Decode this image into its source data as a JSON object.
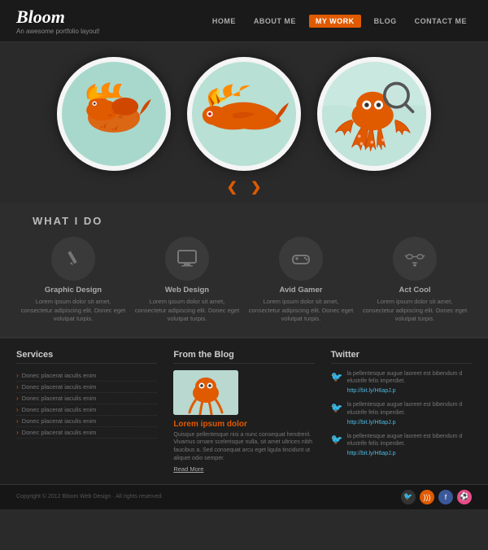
{
  "header": {
    "logo": "Bloom",
    "tagline": "An awesome portfolio layout!",
    "nav": [
      {
        "label": "HOME",
        "active": false
      },
      {
        "label": "ABOUT ME",
        "active": false
      },
      {
        "label": "MY WORK",
        "active": true
      },
      {
        "label": "BLOG",
        "active": false
      },
      {
        "label": "CONTACT ME",
        "active": false
      }
    ]
  },
  "hero": {
    "carousel_prev": "❮",
    "carousel_next": "❯"
  },
  "what_i_do": {
    "title": "WHAT I DO",
    "services": [
      {
        "name": "Graphic Design",
        "desc": "Lorem ipsum dolor sit amet, consectetur adipiscing elit. Donec eget volutpat turpis."
      },
      {
        "name": "Web Design",
        "desc": "Lorem ipsum dolor sit amet, consectetur adipiscing elit. Donec eget volutpat turpis."
      },
      {
        "name": "Avid Gamer",
        "desc": "Lorem ipsum dolor sit amet, consectetur adipiscing elit. Donec eget volutpat turpis."
      },
      {
        "name": "Act Cool",
        "desc": "Lorem ipsum dolor sit amet, consectetur adipiscing elit. Donec eget volutpat turpis."
      }
    ]
  },
  "footer": {
    "services_title": "Services",
    "services_list": [
      "Donec placerat iaculis enim",
      "Donec placerat iaculis enim",
      "Donec placerat iaculis enim",
      "Donec placerat iaculis enim",
      "Donec placerat iaculis enim",
      "Donec placerat iaculis enim"
    ],
    "blog_title": "From the Blog",
    "blog_post_title": "Lorem ipsum dolor",
    "blog_post_text": "Quisque pellentesque nisi a nunc consequat hendrerit. Vivamus ornare scelerisque nulla, sit amet ultrices nibh faucibus a. Sed consequat arcu eget ligula tincidunt ut aliquet odio semper.",
    "read_more": "Read More",
    "twitter_title": "Twitter",
    "tweets": [
      {
        "text": "la pellentesque augue laoreet est bibendum d elustrife felis imperdiet.",
        "link": "http://bit.ly/H6apJ.p"
      },
      {
        "text": "la pellentesque augue laoreet est bibendum d elustrife felis imperdiet.",
        "link": "http://bit.ly/H6apJ.p"
      },
      {
        "text": "la pellentesque augue laoreet est bibendum d elustrife felis imperdiet.",
        "link": "http://bit.ly/H6apJ.p"
      }
    ],
    "copyright": "Copyright © 2012 Bloom Web Design · All rights reserved."
  }
}
